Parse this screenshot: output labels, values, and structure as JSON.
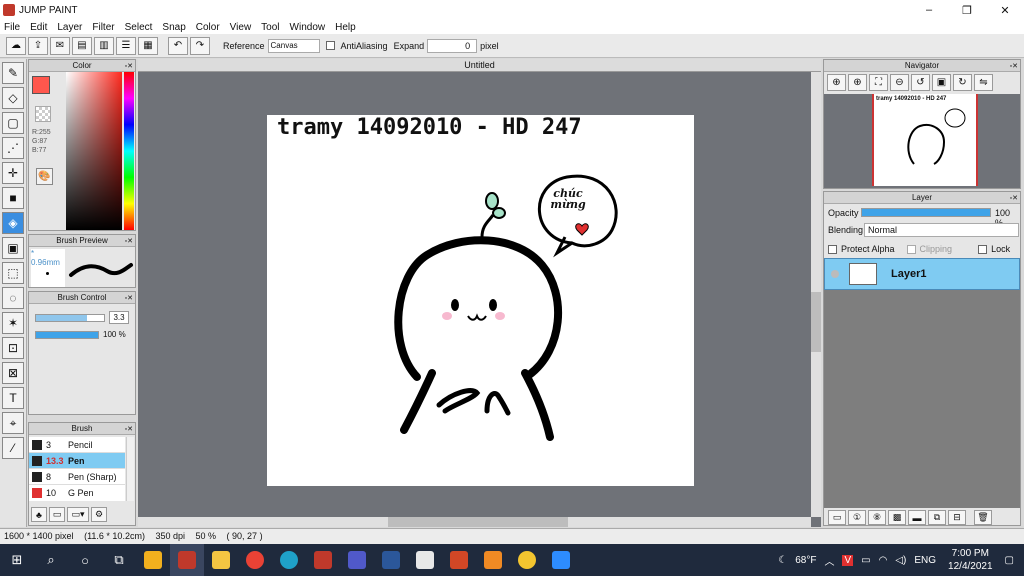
{
  "window": {
    "title": "JUMP PAINT",
    "controls": [
      "–",
      "❐",
      "✕"
    ]
  },
  "menu": [
    "File",
    "Edit",
    "Layer",
    "Filter",
    "Select",
    "Snap",
    "Color",
    "View",
    "Tool",
    "Window",
    "Help"
  ],
  "toolbar": {
    "reference_label": "Reference",
    "reference_value": "Canvas",
    "antialiasing_label": "AntiAliasing",
    "expand_label": "Expand",
    "expand_value": "0",
    "expand_unit": "pixel"
  },
  "color_panel": {
    "title": "Color",
    "r": "R:255",
    "g": "G:87",
    "b": "B:77",
    "current_color": "#ff574d"
  },
  "brush_preview": {
    "title": "Brush Preview",
    "size": "* 0.96mm"
  },
  "brush_control": {
    "title": "Brush Control",
    "size_value": "3.3",
    "opacity_value": "100 %",
    "size_fill": 0.75,
    "opacity_fill": 1.0
  },
  "brush_list": {
    "title": "Brush",
    "items": [
      {
        "size": "3",
        "name": "Pencil",
        "selected": false,
        "color": "#222222"
      },
      {
        "size": "13.3",
        "name": "Pen",
        "selected": true,
        "color": "#222222"
      },
      {
        "size": "8",
        "name": "Pen (Sharp)",
        "selected": false,
        "color": "#222222"
      },
      {
        "size": "10",
        "name": "G Pen",
        "selected": false,
        "color": "#e03030"
      }
    ]
  },
  "document": {
    "tab_title": "Untitled",
    "handwritten_text": "tramy 14092010 - HD 247",
    "bubble_line1": "chúc",
    "bubble_line2": "mừng"
  },
  "navigator": {
    "title": "Navigator",
    "thumb_text": "tramy 14092010 - HD 247"
  },
  "layer_panel": {
    "title": "Layer",
    "opacity_label": "Opacity",
    "opacity_value": "100 %",
    "opacity_fill": 1.0,
    "blending_label": "Blending",
    "blending_value": "Normal",
    "protect_alpha_label": "Protect Alpha",
    "clipping_label": "Clipping",
    "lock_label": "Lock",
    "layers": [
      {
        "name": "Layer1"
      }
    ]
  },
  "status": {
    "size": "1600 * 1400 pixel",
    "physical": "(11.6 * 10.2cm)",
    "dpi": "350 dpi",
    "zoom": "50 %",
    "coords": "( 90, 27 )"
  },
  "taskbar": {
    "weather": "68°F",
    "lang": "ENG",
    "time": "7:00 PM",
    "date": "12/4/2021"
  }
}
